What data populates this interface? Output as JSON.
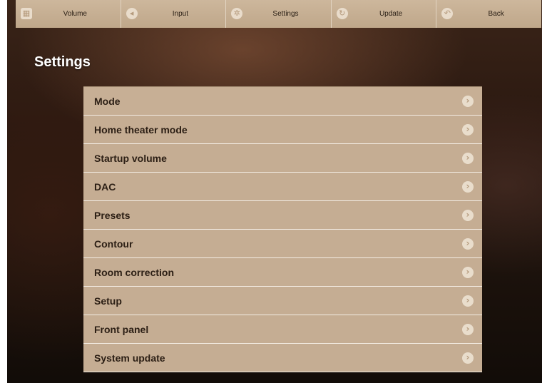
{
  "topbar": {
    "items": [
      {
        "label": "Volume",
        "icon": "grid-icon"
      },
      {
        "label": "Input",
        "icon": "speaker-icon"
      },
      {
        "label": "Settings",
        "icon": "gear-icon"
      },
      {
        "label": "Update",
        "icon": "refresh-icon"
      },
      {
        "label": "Back",
        "icon": "back-arrow-icon"
      }
    ]
  },
  "page": {
    "title": "Settings"
  },
  "menu": {
    "items": [
      {
        "label": "Mode"
      },
      {
        "label": "Home theater mode"
      },
      {
        "label": "Startup volume"
      },
      {
        "label": "DAC"
      },
      {
        "label": "Presets"
      },
      {
        "label": "Contour"
      },
      {
        "label": "Room correction"
      },
      {
        "label": "Setup"
      },
      {
        "label": "Front panel"
      },
      {
        "label": "System update"
      }
    ]
  },
  "colors": {
    "bar": "#c2aa8e",
    "menu_item": "#c5ad93",
    "menu_divider": "#f3ece3",
    "title_text": "#ffffff",
    "item_text": "#2b1e14",
    "background": "#2a1810"
  }
}
